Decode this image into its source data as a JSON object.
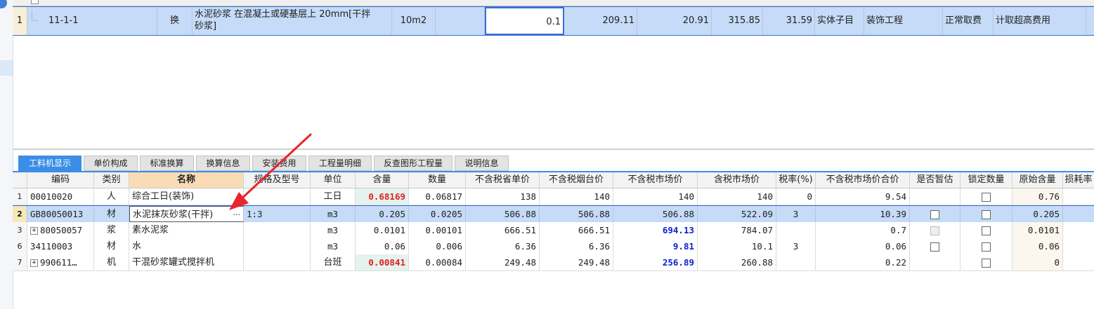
{
  "upper_row": {
    "row_num": "1",
    "code": "11-1-1",
    "kind": "换",
    "name_line1": "水泥砂浆 在混凝土或硬基层上 20mm[干拌",
    "name_line2": "砂浆]",
    "unit": "10m2",
    "quantity": "0.1",
    "price": "209.11",
    "total": "20.91",
    "price2": "315.85",
    "total2": "31.59",
    "type": "实体子目",
    "specialty": "装饰工程",
    "fee": "正常取费",
    "height_fee": "计取超高费用"
  },
  "tabs": [
    "工料机显示",
    "单价构成",
    "标准换算",
    "换算信息",
    "安装费用",
    "工程量明细",
    "反查图形工程量",
    "说明信息"
  ],
  "headers": [
    "编码",
    "类别",
    "名称",
    "规格及型号",
    "单位",
    "含量",
    "数量",
    "不含税省单价",
    "不含税烟台价",
    "不含税市场价",
    "含税市场价",
    "税率(%)",
    "不含税市场价合价",
    "是否暂估",
    "锁定数量",
    "原始含量",
    "损耗率"
  ],
  "rows": [
    {
      "n": "1",
      "code": "00010020",
      "cat": "人",
      "name": "综合工日(装饰)",
      "spec": "",
      "unit": "工日",
      "content": "0.68169",
      "qty": "0.06817",
      "p1": "138",
      "p2": "140",
      "p3": "140",
      "p4": "140",
      "tax": "0",
      "sum": "9.54",
      "temp": "",
      "lock": "box",
      "orig": "0.76"
    },
    {
      "n": "2",
      "code": "GB80050013",
      "cat": "材",
      "name": "水泥抹灰砂浆(干拌)",
      "spec": "1:3",
      "unit": "m3",
      "content": "0.205",
      "qty": "0.0205",
      "p1": "506.88",
      "p2": "506.88",
      "p3": "506.88",
      "p4": "522.09",
      "tax": "3",
      "sum": "10.39",
      "temp": "box",
      "lock": "box",
      "orig": "0.205"
    },
    {
      "n": "3",
      "code": "80050057",
      "cat": "浆",
      "name": "素水泥浆",
      "spec": "",
      "unit": "m3",
      "content": "0.0101",
      "qty": "0.00101",
      "p1": "666.51",
      "p2": "666.51",
      "p3": "694.13",
      "p4": "784.07",
      "tax": "",
      "sum": "0.7",
      "temp": "dis",
      "lock": "box",
      "orig": "0.0101"
    },
    {
      "n": "6",
      "code": "34110003",
      "cat": "材",
      "name": "水",
      "spec": "",
      "unit": "m3",
      "content": "0.06",
      "qty": "0.006",
      "p1": "6.36",
      "p2": "6.36",
      "p3": "9.81",
      "p4": "10.1",
      "tax": "3",
      "sum": "0.06",
      "temp": "box",
      "lock": "box",
      "orig": "0.06"
    },
    {
      "n": "7",
      "code": "990611…",
      "cat": "机",
      "name": "干混砂浆罐式搅拌机",
      "spec": "",
      "unit": "台班",
      "content": "0.00841",
      "qty": "0.00084",
      "p1": "249.48",
      "p2": "249.48",
      "p3": "256.89",
      "p4": "260.88",
      "tax": "",
      "sum": "0.22",
      "temp": "",
      "lock": "box",
      "orig": "0"
    }
  ],
  "icons": {
    "expand": "plus-box-icon",
    "ellipsis": "ellipsis-icon",
    "arrow": "red-arrow-annotation"
  },
  "colors": {
    "selection": "#c5dbf7",
    "tab_active": "#3a8ee6",
    "red_value": "#e02020",
    "blue_value": "#1020d0",
    "arrow": "#e8262c"
  }
}
